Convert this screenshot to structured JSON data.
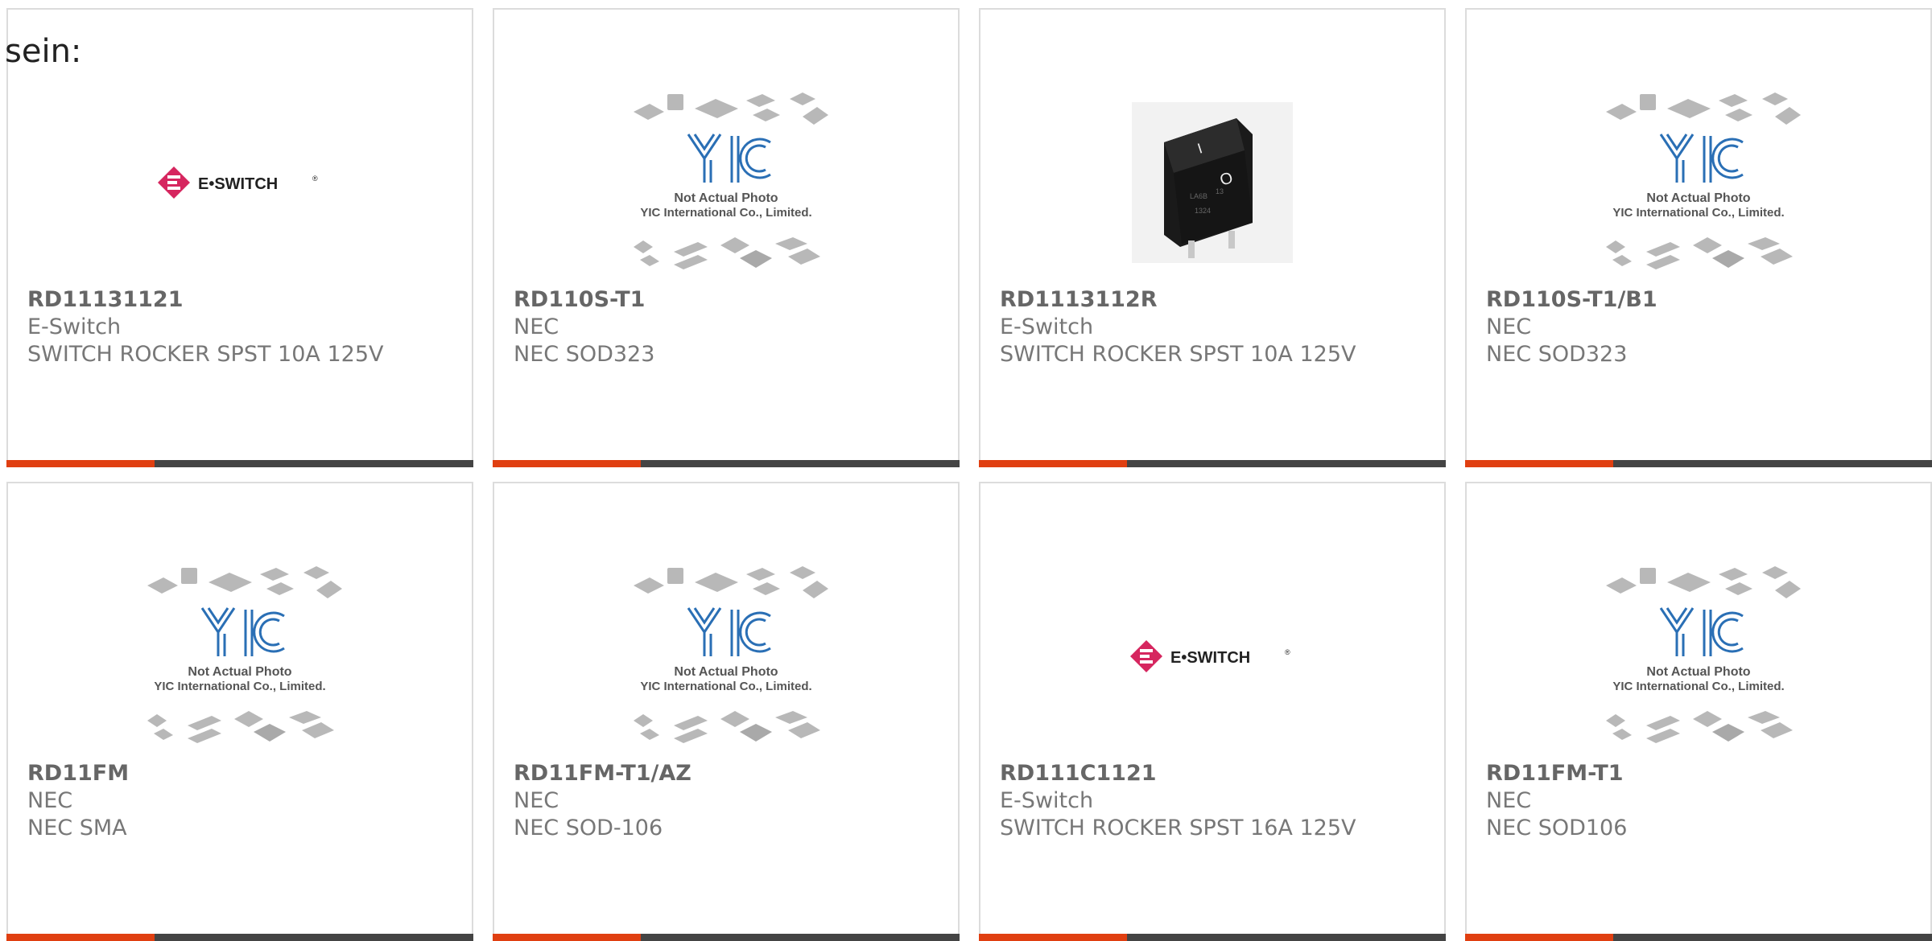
{
  "header": {
    "fragment_text": "sein:"
  },
  "placeholder_image": {
    "line1": "Not Actual Photo",
    "line2": "YIC International Co., Limited.",
    "logo_text": "YIC"
  },
  "eswitch_logo": {
    "text": "E•SWITCH",
    "registered": "®"
  },
  "rocker_marks": {
    "on": "I",
    "off": "O",
    "label1": "LA6B",
    "label2": "13",
    "label3": "1324"
  },
  "colors": {
    "accent": "#e03f11",
    "bar": "#444444",
    "brand_magenta": "#d6265f",
    "yic_blue": "#2a6fb5"
  },
  "products": [
    {
      "part_number": "RD11131121",
      "manufacturer": "E-Switch",
      "description": "SWITCH ROCKER SPST 10A 125V",
      "image": "eswitch-logo"
    },
    {
      "part_number": "RD110S-T1",
      "manufacturer": "NEC",
      "description": "NEC SOD323",
      "image": "not-actual-photo"
    },
    {
      "part_number": "RD1113112R",
      "manufacturer": "E-Switch",
      "description": "SWITCH ROCKER SPST 10A 125V",
      "image": "rocker-switch-photo"
    },
    {
      "part_number": "RD110S-T1/B1",
      "manufacturer": "NEC",
      "description": "NEC SOD323",
      "image": "not-actual-photo"
    },
    {
      "part_number": "RD11FM",
      "manufacturer": "NEC",
      "description": "NEC SMA",
      "image": "not-actual-photo"
    },
    {
      "part_number": "RD11FM-T1/AZ",
      "manufacturer": "NEC",
      "description": "NEC SOD-106",
      "image": "not-actual-photo"
    },
    {
      "part_number": "RD111C1121",
      "manufacturer": "E-Switch",
      "description": "SWITCH ROCKER SPST 16A 125V",
      "image": "eswitch-logo"
    },
    {
      "part_number": "RD11FM-T1",
      "manufacturer": "NEC",
      "description": "NEC SOD106",
      "image": "not-actual-photo"
    }
  ]
}
